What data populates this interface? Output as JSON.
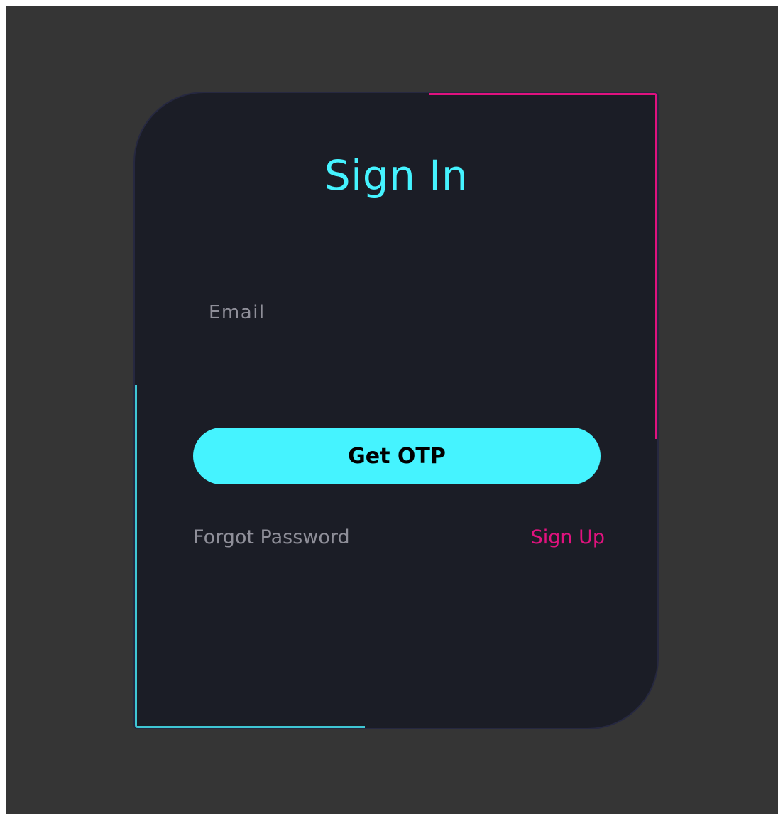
{
  "signin": {
    "title": "Sign In",
    "email_label": "Email",
    "email_value": "",
    "otp_button_label": "Get OTP",
    "forgot_password_label": "Forgot Password",
    "signup_label": "Sign Up"
  },
  "colors": {
    "page_background": "#353535",
    "card_background": "#1b1d26",
    "accent_cyan": "#45f3ff",
    "accent_pink": "#e0127e",
    "muted_text": "#8f8f99"
  }
}
